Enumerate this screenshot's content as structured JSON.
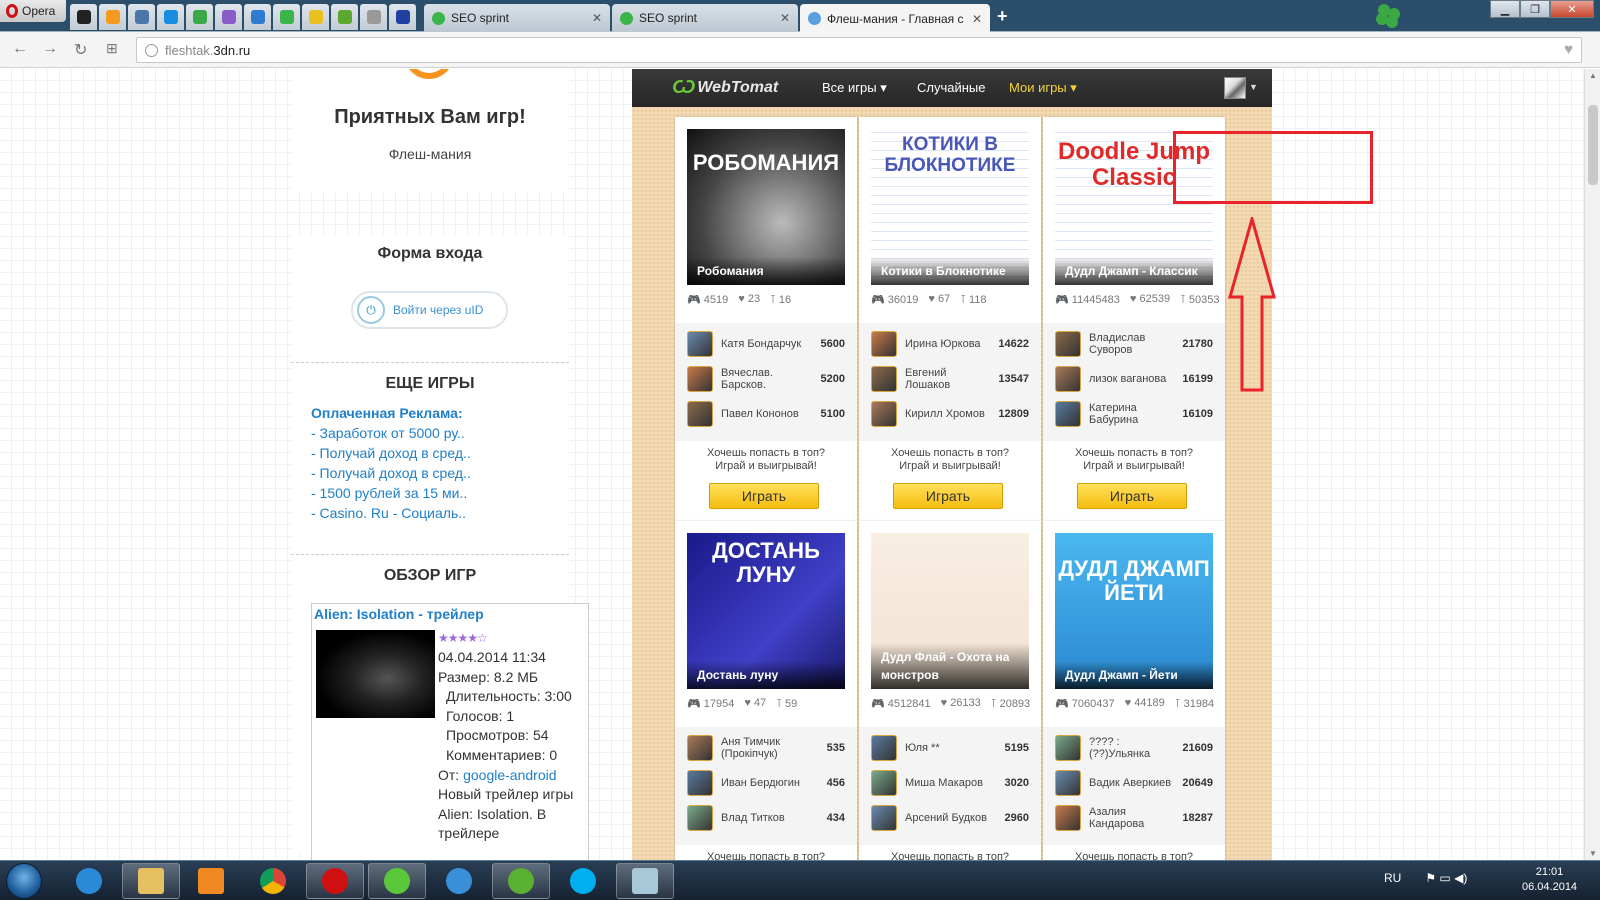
{
  "browser": {
    "menu_label": "Opera",
    "tabs": [
      {
        "title": "SEO sprint"
      },
      {
        "title": "SEO sprint"
      },
      {
        "title": "Флеш-мания - Главная с"
      }
    ],
    "url_domain": "fleshtak.",
    "url_host": "3dn.ru"
  },
  "sidebar": {
    "greeting": "Приятных Вам игр!",
    "site_name": "Флеш-мания",
    "login": {
      "title": "Форма входа",
      "uid_button": "Войти через uID"
    },
    "more_games": {
      "title": "ЕЩЕ ИГРЫ",
      "ad_header": "Оплаченная Реклама:",
      "ads": [
        "- Заработок от 5000 ру..",
        "- Получай доход в сред..",
        "- Получай доход в сред..",
        "- 1500 рублей за 15 ми..",
        "- Casino. Ru - Социаль.."
      ]
    },
    "review": {
      "title": "ОБЗОР ИГР",
      "item_title": "Alien: Isolation - трейлер",
      "stars": "★★★★☆",
      "date": "04.04.2014 11:34",
      "size": "Размер: 8.2 МБ",
      "duration": "Длительность: 3:00",
      "votes": "Голосов: 1",
      "views": "Просмотров: 54",
      "comments": "Комментариев: 0",
      "from_label": "От: ",
      "from_user": "google-android",
      "desc1": "Новый трейлер игры",
      "desc2": "Alien: Isolation. В",
      "desc3": "трейлере"
    }
  },
  "webtomat": {
    "logo": "WebTomat",
    "nav": {
      "all_games": "Все игры ▾",
      "random": "Случайные",
      "my_games": "Мои игры ▾"
    },
    "cta_line1": "Хочешь попасть в топ?",
    "cta_line2": "Играй и выигрывай!",
    "play_label": "Играть",
    "games": [
      {
        "title": "Робомания",
        "art": "РОБОМАНИЯ",
        "plays": "4519",
        "likes": "23",
        "tops": "16",
        "top": [
          {
            "name": "Катя Бондарчук",
            "score": "5600"
          },
          {
            "name": "Вячеслав. Барсков.",
            "score": "5200"
          },
          {
            "name": "Павел Кононов",
            "score": "5100"
          }
        ]
      },
      {
        "title": "Котики в Блокнотике",
        "art": "КОТИКИ В БЛОКНОТИКЕ",
        "plays": "36019",
        "likes": "67",
        "tops": "118",
        "top": [
          {
            "name": "Ирина Юркова",
            "score": "14622"
          },
          {
            "name": "Евгений Лошаков",
            "score": "13547"
          },
          {
            "name": "Кирилл Хромов",
            "score": "12809"
          }
        ]
      },
      {
        "title": "Дудл Джамп - Классик",
        "art": "Doodle Jump Classic",
        "plays": "11445483",
        "likes": "62539",
        "tops": "50353",
        "top": [
          {
            "name": "Владислав Суворов",
            "score": "21780"
          },
          {
            "name": "лизок ваганова",
            "score": "16199"
          },
          {
            "name": "Катерина Бабурина",
            "score": "16109"
          }
        ]
      },
      {
        "title": "Достань луну",
        "art": "ДОСТАНЬ ЛУНУ",
        "plays": "17954",
        "likes": "47",
        "tops": "59",
        "top": [
          {
            "name": "Аня Тимчик (Прокiпчук)",
            "score": "535"
          },
          {
            "name": "Иван Бердюгин",
            "score": "456"
          },
          {
            "name": "Влад Титков",
            "score": "434"
          }
        ]
      },
      {
        "title": "Дудл Флай - Охота на монстров",
        "art": "",
        "plays": "4512841",
        "likes": "26133",
        "tops": "20893",
        "top": [
          {
            "name": "Юля **",
            "score": "5195"
          },
          {
            "name": "Миша Макаров",
            "score": "3020"
          },
          {
            "name": "Арсений Будков",
            "score": "2960"
          }
        ]
      },
      {
        "title": "Дудл Джамп - Йети",
        "art": "ДУДЛ ДЖАМП ЙЕТИ",
        "plays": "7060437",
        "likes": "44189",
        "tops": "31984",
        "top": [
          {
            "name": "???? :(??)Ульянка",
            "score": "21609"
          },
          {
            "name": "Вадик Аверкиев",
            "score": "20649"
          },
          {
            "name": "Азалия Кандарова",
            "score": "18287"
          }
        ]
      }
    ]
  },
  "taskbar": {
    "lang": "RU",
    "time": "21:01",
    "date": "06.04.2014"
  },
  "colors": {
    "accent": "#1f7fc8",
    "annotation": "#e8232a",
    "play": "#f5bd10"
  }
}
